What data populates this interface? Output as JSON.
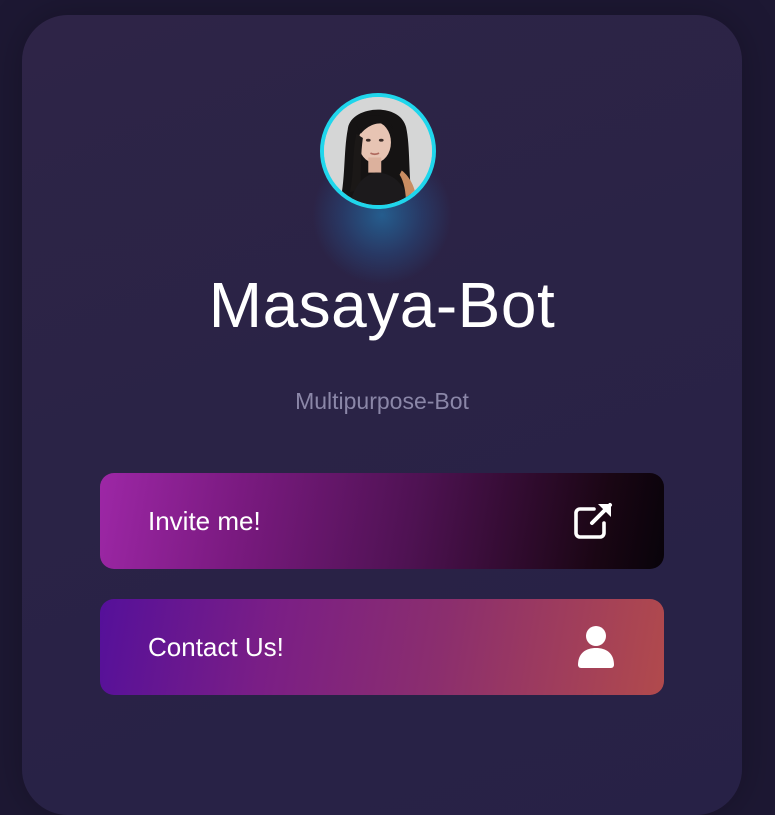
{
  "profile": {
    "name": "Masaya-Bot",
    "tagline": "Multipurpose-Bot",
    "ring_color": "#1fd6ec"
  },
  "buttons": [
    {
      "label": "Invite me!",
      "icon": "external-link-icon"
    },
    {
      "label": "Contact Us!",
      "icon": "user-icon"
    }
  ]
}
